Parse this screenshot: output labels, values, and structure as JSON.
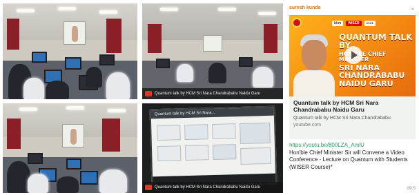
{
  "photos": [
    {
      "kind": "classroom"
    },
    {
      "kind": "classroom",
      "video_caption": "Quantum talk by HCM Sri Nara Chandrababu Naidu Garu"
    },
    {
      "kind": "classroom"
    },
    {
      "kind": "screen",
      "screen_title": "Quantum talk by HCM Sri Nara...",
      "video_caption": "Quantum talk by HCM Sri Nara Chandrababu Naidu Garu"
    }
  ],
  "chat": {
    "sender": "suresh kunda",
    "thumbnail": {
      "badges": [
        "bkm",
        "WISER",
        "♦♦♦♦"
      ],
      "title_lines": [
        "QUANTUM TALK BY",
        "HON'BLE CHIEF MINISTER",
        "SRI NARA CHANDRABABU",
        "NAIDU GARU"
      ]
    },
    "link_card": {
      "title": "Quantum talk by HCM Sri Nara Chandrababu Naidu Garu",
      "description": "Quantum talk by HCM Sri Nara Chandrababu",
      "domain": "youtube.com"
    },
    "message": {
      "url": "https://youtu.be/800LZA_AmlU",
      "text": "Hon'ble Chief Minister Sir will Convene a Video Conference - Lecture on Quantum with Students (WISER Course)*"
    },
    "time": "09:5"
  }
}
